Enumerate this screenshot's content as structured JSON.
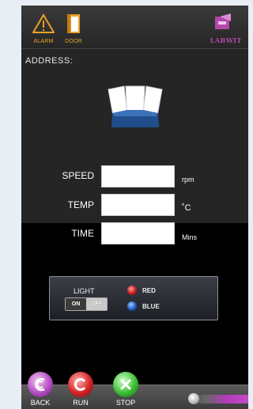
{
  "header": {
    "alarm_label": "ALARM",
    "door_label": "DOOR",
    "brand": "LABWIT"
  },
  "address_label": "ADDRESS:",
  "fields": {
    "speed": {
      "label": "SPEED",
      "value": "",
      "unit": "rpm"
    },
    "temp": {
      "label": "TEMP",
      "value": "",
      "unit": "˚C"
    },
    "time": {
      "label": "TIME",
      "value": "",
      "unit": "Mins"
    }
  },
  "light": {
    "label": "LIGHT",
    "on_label": "ON",
    "off_label": "OFF",
    "red_label": "RED",
    "blue_label": "BLUE",
    "red_color": "#c01515",
    "blue_color": "#1652c0"
  },
  "footer": {
    "back_label": "BACK",
    "run_label": "RUN",
    "stop_label": "STOP"
  },
  "colors": {
    "accent_orange": "#e8a12b",
    "brand_purple": "#b04aa8"
  }
}
